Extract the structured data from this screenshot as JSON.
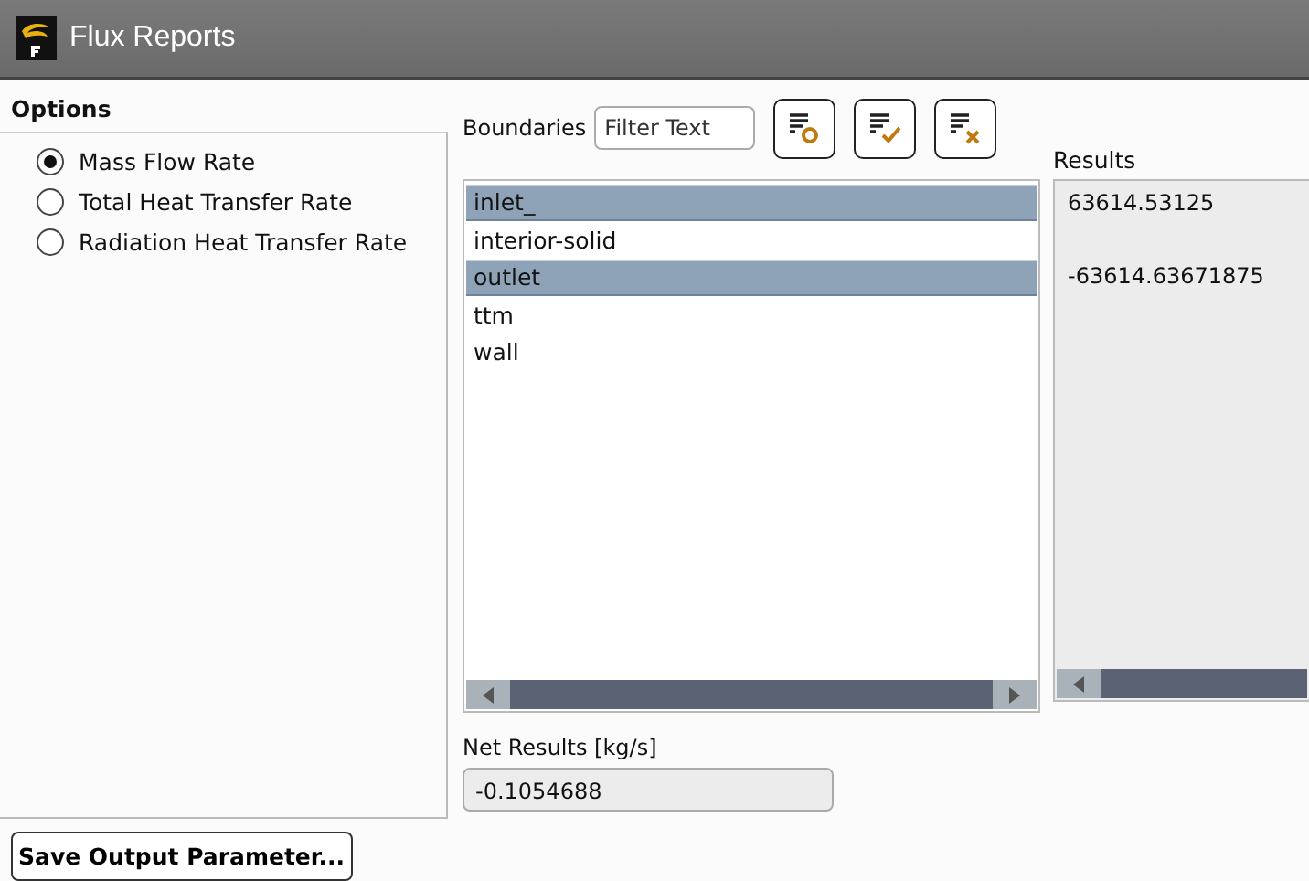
{
  "window": {
    "title": "Flux Reports"
  },
  "options": {
    "title": "Options",
    "items": [
      {
        "label": "Mass Flow Rate",
        "selected": true
      },
      {
        "label": "Total Heat Transfer Rate",
        "selected": false
      },
      {
        "label": "Radiation Heat Transfer Rate",
        "selected": false
      }
    ]
  },
  "boundaries": {
    "label": "Boundaries",
    "filter_placeholder": "Filter Text",
    "items": [
      {
        "name": "inlet_",
        "selected": true,
        "result": "63614.53125"
      },
      {
        "name": "interior-solid",
        "selected": false
      },
      {
        "name": "outlet",
        "selected": true,
        "result": "-63614.63671875"
      },
      {
        "name": "ttm",
        "selected": false
      },
      {
        "name": "wall",
        "selected": false
      }
    ]
  },
  "results": {
    "label": "Results"
  },
  "net_results": {
    "label": "Net Results [kg/s]",
    "value": "-0.1054688"
  },
  "save_button": "Save Output Parameter..."
}
